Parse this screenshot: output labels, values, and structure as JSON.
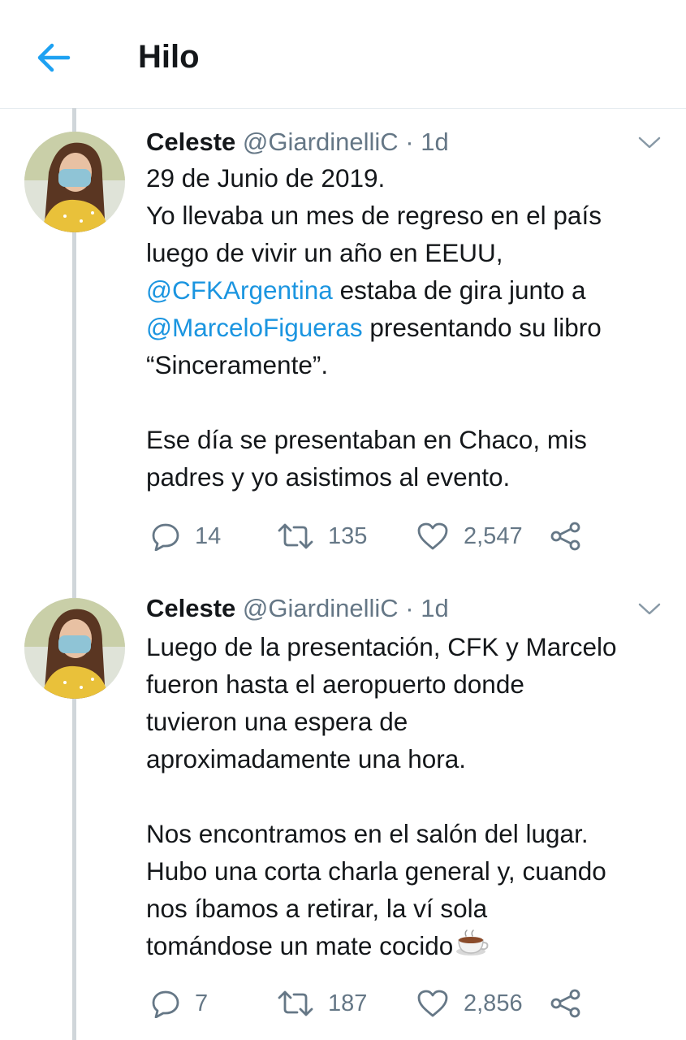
{
  "header": {
    "title": "Hilo"
  },
  "tweets": [
    {
      "name": "Celeste",
      "handle": "@GiardinelliC",
      "separator": "·",
      "time": "1d",
      "text": {
        "line1": "29 de Junio de 2019.",
        "line2": "Yo llevaba un mes de regreso en el país",
        "line3": "luego de vivir un año en EEUU,",
        "mention1": "@CFKArgentina",
        "line4_rest": " estaba de gira junto a",
        "mention2": "@MarceloFigueras",
        "line5_rest": " presentando su libro",
        "line6": "“Sinceramente”.",
        "line7": "Ese día se presentaban en Chaco, mis",
        "line8": "padres y yo asistimos al evento."
      },
      "replies": "14",
      "retweets": "135",
      "likes": "2,547"
    },
    {
      "name": "Celeste",
      "handle": "@GiardinelliC",
      "separator": "·",
      "time": "1d",
      "text": {
        "line1": "Luego de la presentación, CFK y Marcelo",
        "line2": "fueron hasta el aeropuerto donde",
        "line3": "tuvieron una espera de",
        "line4": "aproximadamente una hora.",
        "line5": "Nos encontramos en el salón del lugar.",
        "line6": "Hubo una corta charla general y, cuando",
        "line7": "nos íbamos a retirar, la ví sola",
        "line8": "tomándose un mate cocido"
      },
      "replies": "7",
      "retweets": "187",
      "likes": "2,856"
    }
  ],
  "colors": {
    "accent": "#1da1f2",
    "mention": "#1b95e0",
    "muted": "#657786",
    "thread_line": "#d0d6da"
  },
  "icons": [
    "back-arrow-icon",
    "chevron-down-icon",
    "reply-icon",
    "retweet-icon",
    "like-icon",
    "share-icon",
    "teacup-emoji-icon"
  ]
}
